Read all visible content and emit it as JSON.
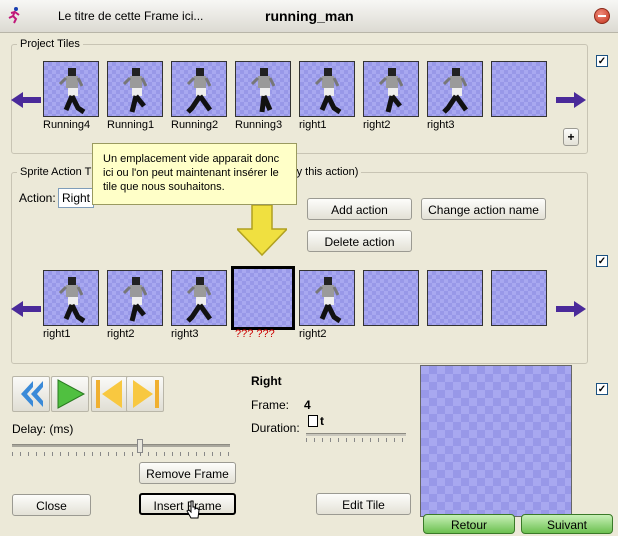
{
  "window": {
    "title_left": "Le titre de cette Frame ici...",
    "title_main": "running_man"
  },
  "project_tiles": {
    "label": "Project Tiles",
    "tiles": [
      "Running4",
      "Running1",
      "Running2",
      "Running3",
      "right1",
      "right2",
      "right3",
      ""
    ],
    "add_label": "+"
  },
  "sprite_action": {
    "label_left": "Sprite Action T",
    "label_right": "dify this action)",
    "action_label": "Action:",
    "action_value": "Right",
    "add_action": "Add action",
    "change_action_name": "Change action name",
    "delete_action": "Delete action",
    "frames": [
      "right1",
      "right2",
      "right3",
      "??? ???",
      "right2",
      "",
      "",
      ""
    ]
  },
  "tooltip": {
    "text": "Un emplacement vide apparait donc ici ou l'on peut maintenant insérer le tile que nous souhaitons."
  },
  "playback": {
    "delay_label": "Delay: (ms)",
    "remove_frame": "Remove Frame",
    "insert_frame": "Insert Frame",
    "close": "Close",
    "edit_tile": "Edit Tile"
  },
  "frame_info": {
    "action_name": "Right",
    "frame_label": "Frame:",
    "frame_value": "4",
    "duration_label": "Duration:",
    "duration_value": "t"
  },
  "nav": {
    "back": "Retour",
    "next": "Suivant"
  },
  "checkmarks": [
    "✓",
    "✓",
    "✓"
  ],
  "colors": {
    "tile_bg": "#a8a8f0",
    "arrow": "#4a2a9a",
    "missing_label": "#cc0000",
    "tooltip_bg": "#ffffc8",
    "nav_green": "#6cc050"
  }
}
